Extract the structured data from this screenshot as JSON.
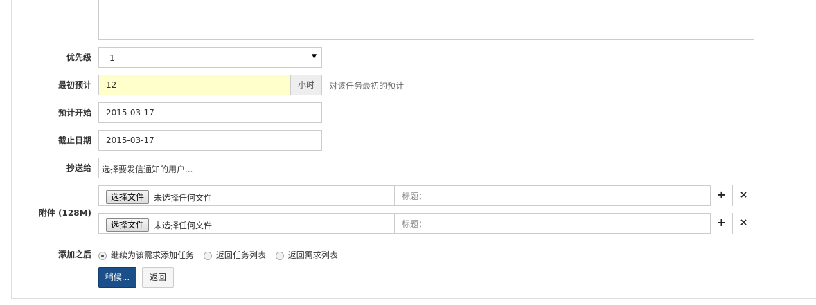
{
  "form": {
    "priority": {
      "label": "优先级",
      "value": "1"
    },
    "estimate": {
      "label": "最初预计",
      "value": "12",
      "unit": "小时",
      "help": "对该任务最初的预计"
    },
    "est_start": {
      "label": "预计开始",
      "value": "2015-03-17"
    },
    "deadline": {
      "label": "截止日期",
      "value": "2015-03-17"
    },
    "mailto": {
      "label": "抄送给",
      "placeholder": "选择要发信通知的用户..."
    },
    "attachments": {
      "label": "附件 (128M)",
      "rows": [
        {
          "choose_label": "选择文件",
          "no_file": "未选择任何文件",
          "title_placeholder": "标题：",
          "add": "+",
          "remove": "×"
        },
        {
          "choose_label": "选择文件",
          "no_file": "未选择任何文件",
          "title_placeholder": "标题：",
          "add": "+",
          "remove": "×"
        }
      ]
    },
    "after": {
      "label": "添加之后",
      "options": [
        "继续为该需求添加任务",
        "返回任务列表",
        "返回需求列表"
      ],
      "selected": 0
    },
    "submit_label": "稍候...",
    "back_label": "返回"
  },
  "colors": {
    "primary": "#1a4f8a",
    "highlight_input": "#ffffcc",
    "border": "#cccccc"
  }
}
